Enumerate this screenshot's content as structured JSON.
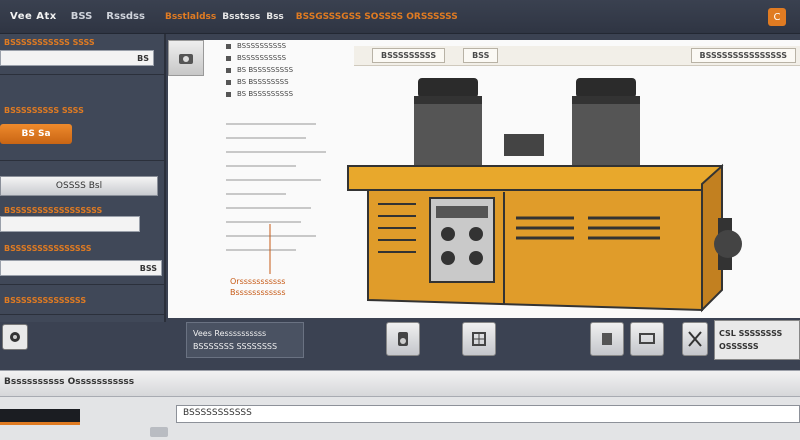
{
  "titlebar": {
    "app_title": "Vee Atx",
    "menu": [
      "BSS",
      "Rssdss"
    ],
    "tabs": [
      "Bsstlaldss",
      "Bsstsss",
      "Bss"
    ],
    "orange_text": "BSSGSSSGSS SOSSSS ORSSSSSS",
    "corner_label": "C"
  },
  "left_panel": {
    "label1": "BSSSSSSSSSSS SSSS",
    "input1_suffix": "BS",
    "label2": "BSSSSSSSSS SSSS",
    "orange_button": "BS Sa",
    "gray_button": "OSSSS Bsl",
    "label3": "BSSSSSSSSSSSSSSSSS",
    "label4": "BSSSSSSSSSSSSSSS",
    "input3_suffix": "BSS",
    "label5": "BSSSSSSSSSSSSSS"
  },
  "canvas": {
    "data_rows": [
      "BSSSSSSSSSS",
      "BSSSSSSSSSS",
      "BS BSSSSSSSSS",
      "BS BSSSSSSSS",
      "BS BSSSSSSSSS"
    ],
    "toolbar": [
      "BSSSSSSSSS",
      "BSS",
      "BSSSSSSSSSSSSSSS"
    ],
    "annotation_line1": "Orsssssssssss",
    "annotation_line2": "Bssssssssssss"
  },
  "bottom_bar": {
    "status_line1": "Vees Ressssssssss",
    "status_line2": "BSSSSSSS SSSSSSSS",
    "info_line1": "CSL SSSSSSSS",
    "info_line2": "OSSSSSS"
  },
  "lower": {
    "title": "Bssssssssss Osssssssssss",
    "footer_field": "BSSSSSSSSSSS"
  },
  "colors": {
    "accent": "#e07b22",
    "machine": "#e0a336",
    "panel": "#3b4252"
  }
}
